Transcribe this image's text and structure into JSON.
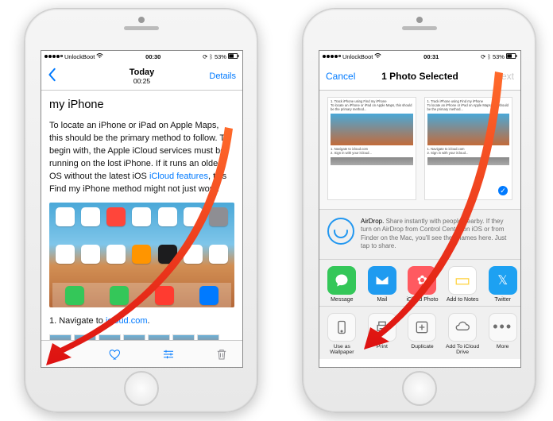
{
  "status": {
    "carrier": "UnlockBoot",
    "left_time": "00:30",
    "right_time": "00:31",
    "battery": "53%"
  },
  "left": {
    "nav_title": "Today",
    "nav_subtitle": "00:25",
    "details": "Details",
    "heading": "my iPhone",
    "paragraph_a": "To locate an iPhone or iPad on Apple Maps, this should be the primary method to follow. To begin with, the Apple iCloud services must be running on the lost iPhone. If it runs an older OS without the latest iOS ",
    "link_text": "iCloud features",
    "paragraph_b": ", this Find my iPhone method might not just work.",
    "step_prefix": "1.  Navigate to ",
    "step_link": "icloud.com",
    "step_suffix": "."
  },
  "right": {
    "cancel": "Cancel",
    "title": "1 Photo Selected",
    "next": "Next",
    "airdrop_bold": "AirDrop.",
    "airdrop_text": " Share instantly with people nearby. If they turn on AirDrop from Control Center on iOS or from Finder on the Mac, you'll see their names here. Just tap to share.",
    "share_apps": [
      {
        "label": "Message",
        "color": "#34c759"
      },
      {
        "label": "Mail",
        "color": "#1f9bf0"
      },
      {
        "label": "iCloud Photo",
        "color": "#ff5a60"
      },
      {
        "label": "Add to Notes",
        "color": "#ffd23e"
      },
      {
        "label": "Twitter",
        "color": "#1da1f2"
      }
    ],
    "actions": [
      {
        "label": "Use as Wallpaper"
      },
      {
        "label": "Print"
      },
      {
        "label": "Duplicate"
      },
      {
        "label": "Add To iCloud Drive"
      },
      {
        "label": "More"
      }
    ]
  }
}
